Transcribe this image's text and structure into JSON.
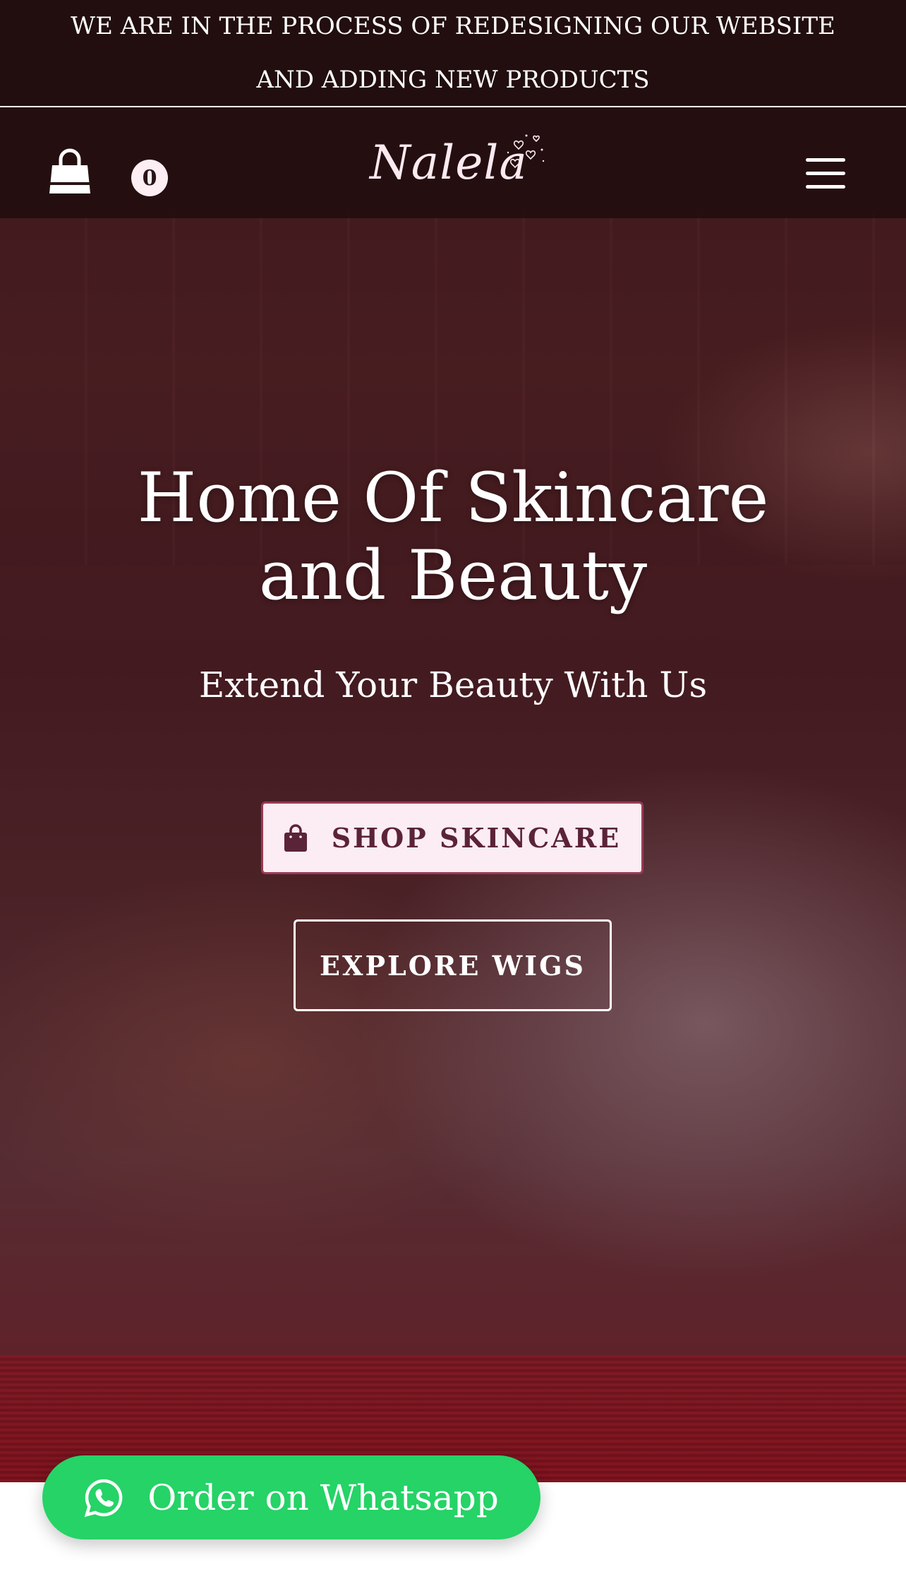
{
  "announcement": {
    "text": "WE ARE IN THE PROCESS OF REDESIGNING OUR WEBSITE AND ADDING NEW PRODUCTS"
  },
  "header": {
    "cart_count": "0",
    "cart_icon": "shopping-bag-icon",
    "logo_text": "Nalela",
    "menu_icon": "hamburger-menu-icon"
  },
  "hero": {
    "title": "Home Of Skincare and Beauty",
    "subtitle": "Extend Your Beauty With Us",
    "shop_button": {
      "label": "SHOP SKINCARE",
      "icon": "shopping-bag-icon"
    },
    "explore_button": {
      "label": "EXPLORE WIGS"
    }
  },
  "whatsapp": {
    "label": "Order on Whatsapp",
    "icon": "whatsapp-icon"
  },
  "colors": {
    "accent_pink": "#fcecf3",
    "accent_plum": "#5b2338",
    "whatsapp_green": "#25d366"
  }
}
